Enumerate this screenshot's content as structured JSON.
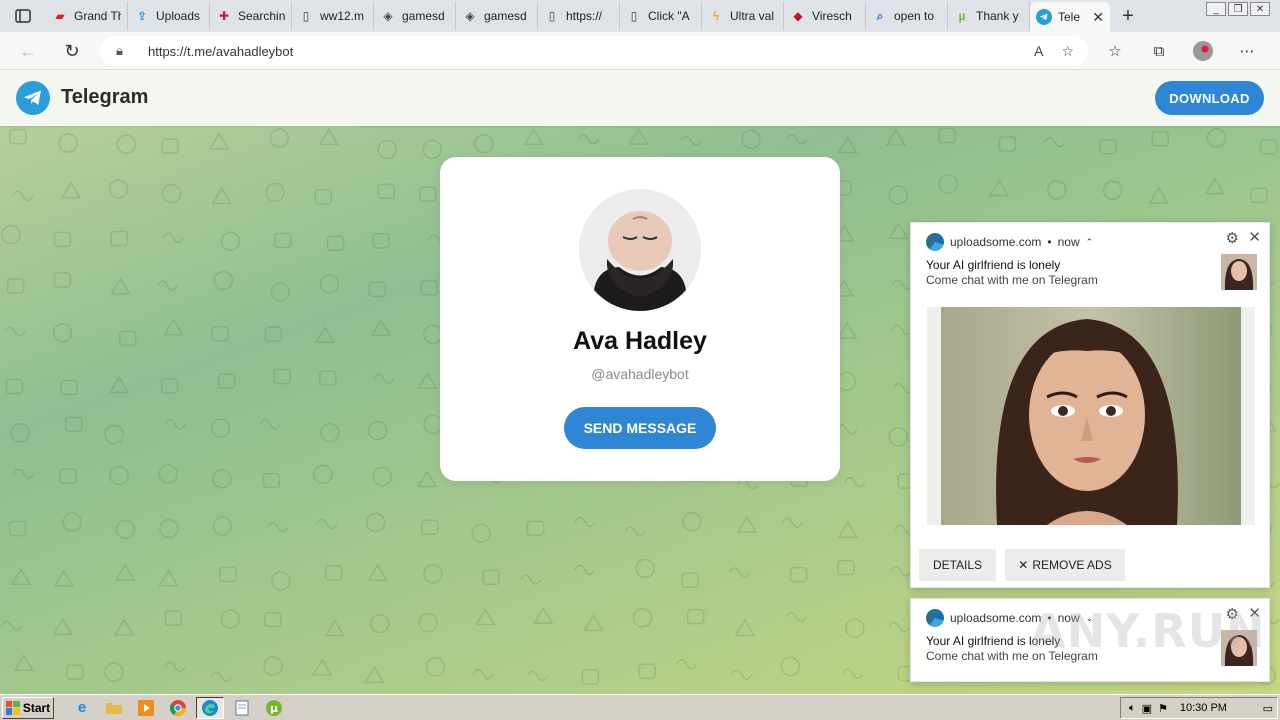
{
  "browser": {
    "tabs": [
      {
        "label": "Grand Th",
        "icon": "red-app-icon",
        "color": "#d22"
      },
      {
        "label": "Uploads",
        "icon": "upload-icon",
        "color": "#2a8ad4"
      },
      {
        "label": "Searchin",
        "icon": "slack-icon",
        "color": "#c2185b"
      },
      {
        "label": "ww12.m",
        "icon": "page-icon",
        "color": "#444"
      },
      {
        "label": "gamesd",
        "icon": "gamesd-icon",
        "color": "#444"
      },
      {
        "label": "gamesd",
        "icon": "gamesd-icon",
        "color": "#444"
      },
      {
        "label": "https://",
        "icon": "page-icon",
        "color": "#444"
      },
      {
        "label": "Click \"A",
        "icon": "page-icon",
        "color": "#444"
      },
      {
        "label": "Ultra val",
        "icon": "lightning-icon",
        "color": "#f5a623"
      },
      {
        "label": "Viresch",
        "icon": "mcafee-icon",
        "color": "#c1121f"
      },
      {
        "label": "open to",
        "icon": "search-icon",
        "color": "#1a73e8"
      },
      {
        "label": "Thank y",
        "icon": "utorrent-icon",
        "color": "#76b82a"
      }
    ],
    "active_tab": {
      "label": "Tele",
      "icon": "telegram-icon",
      "color": "#2a9ed8"
    },
    "url": "https://t.me/avahadleybot"
  },
  "telegram": {
    "brand": "Telegram",
    "download_label": "DOWNLOAD",
    "accent": "#2f86d4"
  },
  "profile": {
    "name": "Ava Hadley",
    "handle": "@avahadleybot",
    "send_label": "SEND MESSAGE"
  },
  "notifications": [
    {
      "source": "uploadsome.com",
      "time": "now",
      "title": "Your AI girlfriend is lonely",
      "body": "Come chat with me on Telegram",
      "details_label": "DETAILS",
      "remove_ads_label": "REMOVE ADS",
      "expanded": true
    },
    {
      "source": "uploadsome.com",
      "time": "now",
      "title": "Your AI girlfriend is lonely",
      "body": "Come chat with me on Telegram",
      "expanded": false
    }
  ],
  "taskbar": {
    "start_label": "Start",
    "clock": "10:30 PM",
    "apps": [
      "ie-icon",
      "folder-icon",
      "media-icon",
      "chrome-icon",
      "edge-icon",
      "notepad-icon",
      "utorrent-icon"
    ]
  },
  "watermark": "ANY.RUN"
}
